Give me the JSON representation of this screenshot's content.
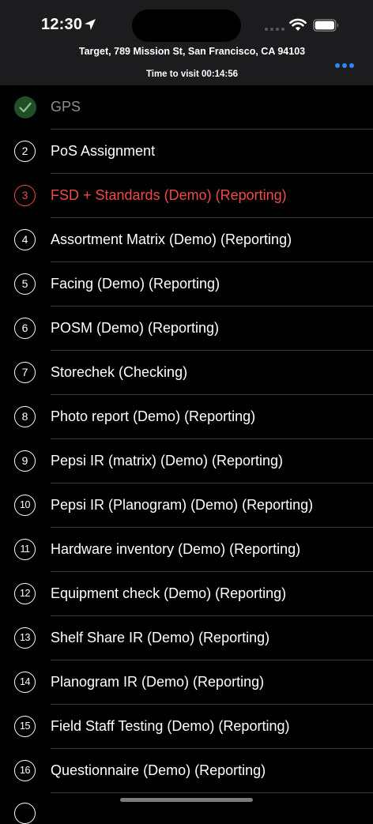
{
  "status_bar": {
    "time": "12:30",
    "location_icon": "location-arrow-icon",
    "wifi_icon": "wifi-icon",
    "battery_icon": "battery-icon"
  },
  "header": {
    "address": "Target, 789 Mission St, San Francisco, CA 94103",
    "timer": "Time to visit 00:14:56",
    "more_icon": "ellipsis-icon",
    "accent_color": "#2f86f6"
  },
  "colors": {
    "active": "#ee4a47",
    "done_badge": "#1e4f26",
    "done_check": "#8fbf8a",
    "muted_text": "#8d8d92"
  },
  "steps": [
    {
      "number": "",
      "label": "GPS",
      "state": "done"
    },
    {
      "number": "2",
      "label": "PoS Assignment",
      "state": "normal"
    },
    {
      "number": "3",
      "label": "FSD + Standards (Demo) (Reporting)",
      "state": "active"
    },
    {
      "number": "4",
      "label": "Assortment Matrix (Demo) (Reporting)",
      "state": "normal"
    },
    {
      "number": "5",
      "label": "Facing (Demo) (Reporting)",
      "state": "normal"
    },
    {
      "number": "6",
      "label": "POSM (Demo) (Reporting)",
      "state": "normal"
    },
    {
      "number": "7",
      "label": "Storechek (Checking)",
      "state": "normal"
    },
    {
      "number": "8",
      "label": "Photo report (Demo) (Reporting)",
      "state": "normal"
    },
    {
      "number": "9",
      "label": "Pepsi IR (matrix) (Demo) (Reporting)",
      "state": "normal"
    },
    {
      "number": "10",
      "label": "Pepsi IR (Planogram) (Demo) (Reporting)",
      "state": "normal"
    },
    {
      "number": "11",
      "label": "Hardware inventory (Demo) (Reporting)",
      "state": "normal"
    },
    {
      "number": "12",
      "label": "Equipment check (Demo) (Reporting)",
      "state": "normal"
    },
    {
      "number": "13",
      "label": "Shelf Share IR (Demo) (Reporting)",
      "state": "normal"
    },
    {
      "number": "14",
      "label": "Planogram IR (Demo) (Reporting)",
      "state": "normal"
    },
    {
      "number": "15",
      "label": "Field Staff Testing (Demo) (Reporting)",
      "state": "normal"
    },
    {
      "number": "16",
      "label": "Questionnaire (Demo) (Reporting)",
      "state": "normal"
    }
  ]
}
